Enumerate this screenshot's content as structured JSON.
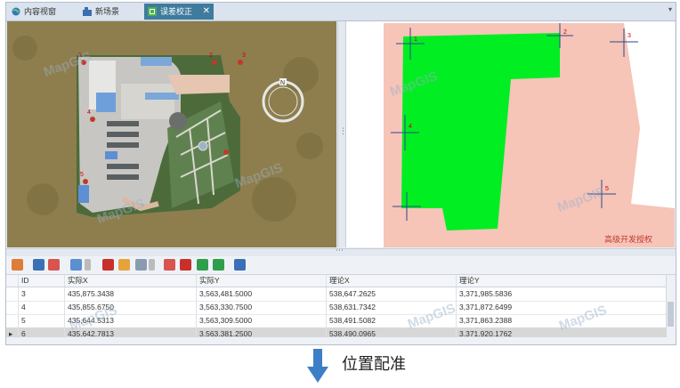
{
  "tabs": [
    {
      "label": "内容视窗",
      "icon": "globe-icon"
    },
    {
      "label": "新场景",
      "icon": "scene-icon"
    },
    {
      "label": "误差校正",
      "icon": "correction-icon",
      "active": true
    }
  ],
  "tab_dropdown": "▾",
  "left_view": {
    "markers": [
      "1",
      "2",
      "3",
      "4",
      "5"
    ],
    "compass_label": "N",
    "watermarks": [
      "MapGIS",
      "MapGIS",
      "MapGIS"
    ]
  },
  "right_view": {
    "markers": [
      "1",
      "2",
      "3",
      "4",
      "5"
    ],
    "license_text": "高级开发授权",
    "watermarks": [
      "MapGIS",
      "MapGIS"
    ]
  },
  "splitter_grip": "⋮",
  "hsplit_grip": "⋯",
  "toolbar_icons": [
    "layers-icon",
    "save-icon",
    "export-icon",
    "pointer-icon",
    "dropdown-icon",
    "delete-icon",
    "edit-icon",
    "grid-icon",
    "dropdown-icon",
    "add-point-icon",
    "remove-point-icon",
    "import-icon",
    "export-table-icon",
    "view-icon"
  ],
  "table": {
    "columns": [
      "ID",
      "实际X",
      "实际Y",
      "理论X",
      "理论Y"
    ],
    "rows": [
      {
        "marker": "",
        "id": "3",
        "x": "435,875.3438",
        "y": "3,563,481.5000",
        "tx": "538,647.2625",
        "ty": "3,371,985.5836"
      },
      {
        "marker": "",
        "id": "4",
        "x": "435,855.6750",
        "y": "3,563,330.7500",
        "tx": "538,631.7342",
        "ty": "3,371,872.6499"
      },
      {
        "marker": "",
        "id": "5",
        "x": "435,644.5313",
        "y": "3,563,309.5000",
        "tx": "538,491.5082",
        "ty": "3,371,863.2388"
      },
      {
        "marker": "▸",
        "id": "6",
        "x": "435,642.7813",
        "y": "3,563,381.2500",
        "tx": "538,490.0965",
        "ty": "3,371,920.1762"
      }
    ],
    "watermarks": [
      "MapGIS",
      "MapGIS",
      "MapGIS"
    ]
  },
  "caption": "位置配准",
  "colors": {
    "tab_active": "#3f7b9c",
    "green_polygon": "#00ee22",
    "pink_area": "#f7c4b8",
    "arrow": "#3d7fc6"
  }
}
